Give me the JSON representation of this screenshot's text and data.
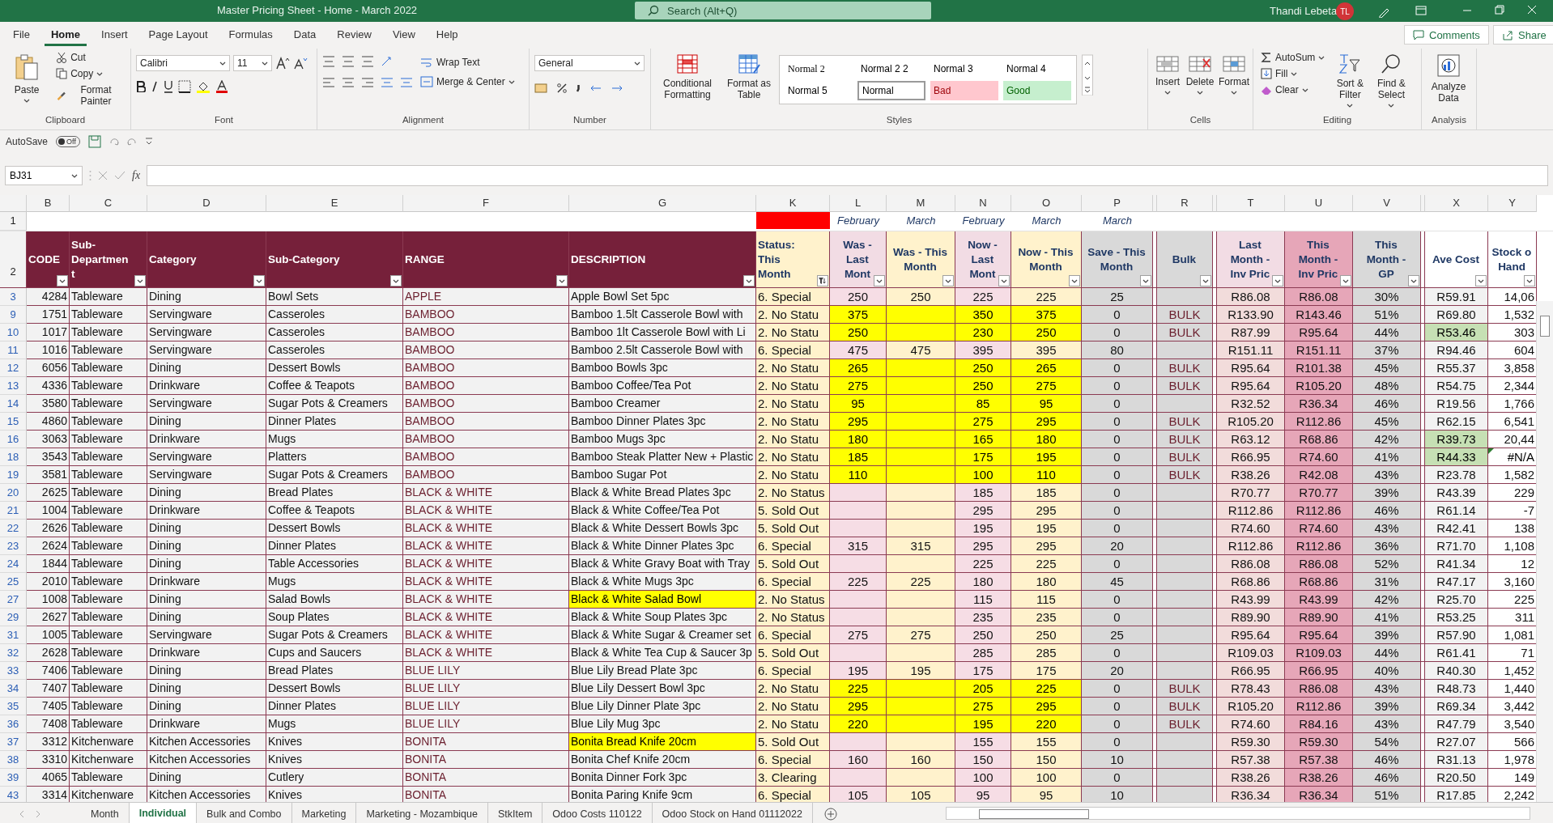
{
  "title_bar": {
    "title": "Master Pricing Sheet - Home - March 2022",
    "search": {
      "placeholder": "Search (Alt+Q)"
    },
    "user": "Thandi Lebeta",
    "avatar": "TL"
  },
  "menu_tabs": [
    {
      "label": "File",
      "selected": false
    },
    {
      "label": "Home",
      "selected": true
    },
    {
      "label": "Insert",
      "selected": false
    },
    {
      "label": "Page Layout",
      "selected": false
    },
    {
      "label": "Formulas",
      "selected": false
    },
    {
      "label": "Data",
      "selected": false
    },
    {
      "label": "Review",
      "selected": false
    },
    {
      "label": "View",
      "selected": false
    },
    {
      "label": "Help",
      "selected": false
    }
  ],
  "header_buttons": {
    "comments": "Comments",
    "share": "Share"
  },
  "ribbon": {
    "clipboard": {
      "paste": "Paste",
      "cut": "Cut",
      "copy": "Copy",
      "format_painter": "Format Painter",
      "label": "Clipboard"
    },
    "font": {
      "family": "Calibri",
      "size": "11",
      "label": "Font"
    },
    "alignment": {
      "wrap": "Wrap Text",
      "merge": "Merge & Center",
      "label": "Alignment"
    },
    "number": {
      "format": "General",
      "label": "Number"
    },
    "styles": {
      "conditional": "Conditional Formatting",
      "format_table": "Format as Table",
      "label": "Styles",
      "gallery": [
        {
          "name": "Normal 2",
          "kind": "serif",
          "selected": false
        },
        {
          "name": "Normal 2 2",
          "kind": "plain",
          "selected": false
        },
        {
          "name": "Normal 3",
          "kind": "plain",
          "selected": false
        },
        {
          "name": "Normal 4",
          "kind": "plain",
          "selected": false
        },
        {
          "name": "Normal 5",
          "kind": "plain",
          "selected": false
        },
        {
          "name": "Normal",
          "kind": "plain",
          "selected": true
        },
        {
          "name": "Bad",
          "kind": "bad",
          "selected": false
        },
        {
          "name": "Good",
          "kind": "good",
          "selected": false
        }
      ]
    },
    "cells": {
      "insert": "Insert",
      "delete": "Delete",
      "format": "Format",
      "label": "Cells"
    },
    "editing": {
      "autosum": "AutoSum",
      "fill": "Fill",
      "clear": "Clear",
      "sort": "Sort & Filter",
      "find": "Find & Select",
      "label": "Editing"
    },
    "analysis": {
      "analyze": "Analyze Data",
      "label": "Analysis"
    }
  },
  "quick_access": {
    "autosave": "AutoSave",
    "autosave_on": false,
    "toggle_label": "Off"
  },
  "formula_bar": {
    "name_box": "BJ31",
    "function_symbol": "fx"
  },
  "sheet": {
    "header_row": "2",
    "period_row": "1",
    "columns": [
      {
        "letter": "B",
        "header": [
          "CODE"
        ],
        "filtered": false
      },
      {
        "letter": "C",
        "header": [
          "Sub-",
          "Departmen",
          "t"
        ],
        "filtered": false
      },
      {
        "letter": "D",
        "header": [
          "Category"
        ],
        "filtered": false
      },
      {
        "letter": "E",
        "header": [
          "Sub-Category"
        ],
        "filtered": false
      },
      {
        "letter": "F",
        "header": [
          "RANGE"
        ],
        "filtered": false
      },
      {
        "letter": "G",
        "header": [
          "DESCRIPTION"
        ],
        "filtered": false
      },
      {
        "letter": "K",
        "header": [
          "Status:",
          "This",
          "Month"
        ],
        "filtered": true,
        "marked": true
      },
      {
        "letter": "L",
        "header": [
          "Was -",
          "Last",
          "Mont"
        ],
        "filtered": false,
        "period": "February"
      },
      {
        "letter": "M",
        "header": [
          "Was - This",
          "Month"
        ],
        "filtered": false,
        "period": "March"
      },
      {
        "letter": "N",
        "header": [
          "Now -",
          "Last",
          "Mont"
        ],
        "filtered": false,
        "period": "February"
      },
      {
        "letter": "O",
        "header": [
          "Now - This",
          "Month"
        ],
        "filtered": false,
        "period": "March"
      },
      {
        "letter": "P",
        "header": [
          "Save - This",
          "Month"
        ],
        "filtered": false,
        "period": "March"
      },
      {
        "letter": "R",
        "header": [
          "Bulk"
        ],
        "filtered": false
      },
      {
        "letter": "T",
        "header": [
          "Last",
          "Month -",
          "Inv Pric"
        ],
        "filtered": false
      },
      {
        "letter": "U",
        "header": [
          "This",
          "Month -",
          "Inv Pric"
        ],
        "filtered": false
      },
      {
        "letter": "V",
        "header": [
          "This",
          "Month -",
          "GP"
        ],
        "filtered": false
      },
      {
        "letter": "X",
        "header": [
          "Ave Cost"
        ],
        "filtered": false
      },
      {
        "letter": "Y",
        "header": [
          "Stock o",
          "Hand"
        ],
        "filtered": false
      }
    ],
    "rows": [
      {
        "row": "3",
        "cells": [
          "4284",
          "Tableware",
          "Dining",
          "Bowl Sets",
          "APPLE",
          "Apple Bowl Set 5pc",
          "6. Special",
          "250",
          "250",
          "225",
          "225",
          "25",
          null,
          "R86.08",
          "R86.08",
          "30%",
          "R59.91",
          "14,06"
        ],
        "price_highlight": false,
        "description_highlight": false,
        "cost_highlight": false,
        "stock_warning": false
      },
      {
        "row": "9",
        "cells": [
          "1751",
          "Tableware",
          "Servingware",
          "Casseroles",
          "BAMBOO",
          "Bamboo 1.5lt Casserole Bowl with",
          "2. No Statu",
          "375",
          null,
          "350",
          "375",
          "0",
          "BULK",
          "R133.90",
          "R143.46",
          "51%",
          "R69.80",
          "1,532"
        ],
        "price_highlight": true,
        "description_highlight": false,
        "cost_highlight": false,
        "stock_warning": false
      },
      {
        "row": "10",
        "cells": [
          "1017",
          "Tableware",
          "Servingware",
          "Casseroles",
          "BAMBOO",
          "Bamboo 1lt Casserole Bowl with Li",
          "2. No Statu",
          "250",
          null,
          "230",
          "250",
          "0",
          "BULK",
          "R87.99",
          "R95.64",
          "44%",
          "R53.46",
          "303"
        ],
        "price_highlight": true,
        "description_highlight": false,
        "cost_highlight": true,
        "stock_warning": false
      },
      {
        "row": "11",
        "cells": [
          "1016",
          "Tableware",
          "Servingware",
          "Casseroles",
          "BAMBOO",
          "Bamboo 2.5lt Casserole Bowl with",
          "6. Special",
          "475",
          "475",
          "395",
          "395",
          "80",
          null,
          "R151.11",
          "R151.11",
          "37%",
          "R94.46",
          "604"
        ],
        "price_highlight": false,
        "description_highlight": false,
        "cost_highlight": false,
        "stock_warning": false
      },
      {
        "row": "12",
        "cells": [
          "6056",
          "Tableware",
          "Dining",
          "Dessert Bowls",
          "BAMBOO",
          "Bamboo Bowls 3pc",
          "2. No Statu",
          "265",
          null,
          "250",
          "265",
          "0",
          "BULK",
          "R95.64",
          "R101.38",
          "45%",
          "R55.37",
          "3,858"
        ],
        "price_highlight": true,
        "description_highlight": false,
        "cost_highlight": false,
        "stock_warning": false
      },
      {
        "row": "13",
        "cells": [
          "4336",
          "Tableware",
          "Drinkware",
          "Coffee & Teapots",
          "BAMBOO",
          "Bamboo Coffee/Tea Pot",
          "2. No Statu",
          "275",
          null,
          "250",
          "275",
          "0",
          "BULK",
          "R95.64",
          "R105.20",
          "48%",
          "R54.75",
          "2,344"
        ],
        "price_highlight": true,
        "description_highlight": false,
        "cost_highlight": false,
        "stock_warning": false
      },
      {
        "row": "14",
        "cells": [
          "3580",
          "Tableware",
          "Servingware",
          "Sugar Pots & Creamers",
          "BAMBOO",
          "Bamboo Creamer",
          "2. No Statu",
          "95",
          null,
          "85",
          "95",
          "0",
          null,
          "R32.52",
          "R36.34",
          "46%",
          "R19.56",
          "1,766"
        ],
        "price_highlight": true,
        "description_highlight": false,
        "cost_highlight": false,
        "stock_warning": false
      },
      {
        "row": "15",
        "cells": [
          "4860",
          "Tableware",
          "Dining",
          "Dinner Plates",
          "BAMBOO",
          "Bamboo Dinner Plates 3pc",
          "2. No Statu",
          "295",
          null,
          "275",
          "295",
          "0",
          "BULK",
          "R105.20",
          "R112.86",
          "45%",
          "R62.15",
          "6,541"
        ],
        "price_highlight": true,
        "description_highlight": false,
        "cost_highlight": false,
        "stock_warning": false
      },
      {
        "row": "16",
        "cells": [
          "3063",
          "Tableware",
          "Drinkware",
          "Mugs",
          "BAMBOO",
          "Bamboo Mugs 3pc",
          "2. No Statu",
          "180",
          null,
          "165",
          "180",
          "0",
          "BULK",
          "R63.12",
          "R68.86",
          "42%",
          "R39.73",
          "20,44"
        ],
        "price_highlight": true,
        "description_highlight": false,
        "cost_highlight": true,
        "stock_warning": false
      },
      {
        "row": "18",
        "cells": [
          "3543",
          "Tableware",
          "Servingware",
          "Platters",
          "BAMBOO",
          "Bamboo Steak Platter New + Plastic",
          "2. No Statu",
          "185",
          null,
          "175",
          "195",
          "0",
          "BULK",
          "R66.95",
          "R74.60",
          "41%",
          "R44.33",
          "#N/A"
        ],
        "price_highlight": true,
        "description_highlight": false,
        "cost_highlight": true,
        "stock_warning": true
      },
      {
        "row": "19",
        "cells": [
          "3581",
          "Tableware",
          "Servingware",
          "Sugar Pots & Creamers",
          "BAMBOO",
          "Bamboo Sugar Pot",
          "2. No Statu",
          "110",
          null,
          "100",
          "110",
          "0",
          "BULK",
          "R38.26",
          "R42.08",
          "43%",
          "R23.78",
          "1,582"
        ],
        "price_highlight": true,
        "description_highlight": false,
        "cost_highlight": false,
        "stock_warning": false
      },
      {
        "row": "20",
        "cells": [
          "2625",
          "Tableware",
          "Dining",
          "Bread Plates",
          "BLACK & WHITE",
          "Black & White Bread Plates 3pc",
          "2. No Status",
          null,
          null,
          "185",
          "185",
          "0",
          null,
          "R70.77",
          "R70.77",
          "39%",
          "R43.39",
          "229"
        ],
        "price_highlight": false,
        "description_highlight": false,
        "cost_highlight": false,
        "stock_warning": false
      },
      {
        "row": "21",
        "cells": [
          "1004",
          "Tableware",
          "Drinkware",
          "Coffee & Teapots",
          "BLACK & WHITE",
          "Black & White Coffee/Tea Pot",
          "5. Sold Out",
          null,
          null,
          "295",
          "295",
          "0",
          null,
          "R112.86",
          "R112.86",
          "46%",
          "R61.14",
          "-7"
        ],
        "price_highlight": false,
        "description_highlight": false,
        "cost_highlight": false,
        "stock_warning": false
      },
      {
        "row": "22",
        "cells": [
          "2626",
          "Tableware",
          "Dining",
          "Dessert Bowls",
          "BLACK & WHITE",
          "Black & White Dessert Bowls 3pc",
          "5. Sold Out",
          null,
          null,
          "195",
          "195",
          "0",
          null,
          "R74.60",
          "R74.60",
          "43%",
          "R42.41",
          "138"
        ],
        "price_highlight": false,
        "description_highlight": false,
        "cost_highlight": false,
        "stock_warning": false
      },
      {
        "row": "23",
        "cells": [
          "2624",
          "Tableware",
          "Dining",
          "Dinner Plates",
          "BLACK & WHITE",
          "Black & White Dinner Plates 3pc",
          "6. Special",
          "315",
          "315",
          "295",
          "295",
          "20",
          null,
          "R112.86",
          "R112.86",
          "36%",
          "R71.70",
          "1,108"
        ],
        "price_highlight": false,
        "description_highlight": false,
        "cost_highlight": false,
        "stock_warning": false
      },
      {
        "row": "24",
        "cells": [
          "1844",
          "Tableware",
          "Dining",
          "Table Accessories",
          "BLACK & WHITE",
          "Black & White Gravy Boat with Tray",
          "5. Sold Out",
          null,
          null,
          "225",
          "225",
          "0",
          null,
          "R86.08",
          "R86.08",
          "52%",
          "R41.34",
          "12"
        ],
        "price_highlight": false,
        "description_highlight": false,
        "cost_highlight": false,
        "stock_warning": false
      },
      {
        "row": "25",
        "cells": [
          "2010",
          "Tableware",
          "Drinkware",
          "Mugs",
          "BLACK & WHITE",
          "Black & White Mugs 3pc",
          "6. Special",
          "225",
          "225",
          "180",
          "180",
          "45",
          null,
          "R68.86",
          "R68.86",
          "31%",
          "R47.17",
          "3,160"
        ],
        "price_highlight": false,
        "description_highlight": false,
        "cost_highlight": false,
        "stock_warning": false
      },
      {
        "row": "27",
        "cells": [
          "1008",
          "Tableware",
          "Dining",
          "Salad Bowls",
          "BLACK & WHITE",
          "Black & White Salad Bowl",
          "2. No Status",
          null,
          null,
          "115",
          "115",
          "0",
          null,
          "R43.99",
          "R43.99",
          "42%",
          "R25.70",
          "225"
        ],
        "price_highlight": false,
        "description_highlight": true,
        "cost_highlight": false,
        "stock_warning": false
      },
      {
        "row": "29",
        "cells": [
          "2627",
          "Tableware",
          "Dining",
          "Soup Plates",
          "BLACK & WHITE",
          "Black & White Soup Plates 3pc",
          "2. No Status",
          null,
          null,
          "235",
          "235",
          "0",
          null,
          "R89.90",
          "R89.90",
          "41%",
          "R53.25",
          "311"
        ],
        "price_highlight": false,
        "description_highlight": false,
        "cost_highlight": false,
        "stock_warning": false
      },
      {
        "row": "31",
        "cells": [
          "1005",
          "Tableware",
          "Servingware",
          "Sugar Pots & Creamers",
          "BLACK & WHITE",
          "Black & White Sugar & Creamer set",
          "6. Special",
          "275",
          "275",
          "250",
          "250",
          "25",
          null,
          "R95.64",
          "R95.64",
          "39%",
          "R57.90",
          "1,081"
        ],
        "price_highlight": false,
        "description_highlight": false,
        "cost_highlight": false,
        "stock_warning": false
      },
      {
        "row": "32",
        "cells": [
          "2628",
          "Tableware",
          "Drinkware",
          "Cups and Saucers",
          "BLACK & WHITE",
          "Black & White Tea Cup & Saucer 3p",
          "5. Sold Out",
          null,
          null,
          "285",
          "285",
          "0",
          null,
          "R109.03",
          "R109.03",
          "44%",
          "R61.41",
          "71"
        ],
        "price_highlight": false,
        "description_highlight": false,
        "cost_highlight": false,
        "stock_warning": false
      },
      {
        "row": "33",
        "cells": [
          "7406",
          "Tableware",
          "Dining",
          "Bread Plates",
          "BLUE LILY",
          "Blue Lily Bread Plate 3pc",
          "6. Special",
          "195",
          "195",
          "175",
          "175",
          "20",
          null,
          "R66.95",
          "R66.95",
          "40%",
          "R40.30",
          "1,452"
        ],
        "price_highlight": false,
        "description_highlight": false,
        "cost_highlight": false,
        "stock_warning": false
      },
      {
        "row": "34",
        "cells": [
          "7407",
          "Tableware",
          "Dining",
          "Dessert Bowls",
          "BLUE LILY",
          "Blue Lily Dessert Bowl 3pc",
          "2. No Statu",
          "225",
          null,
          "205",
          "225",
          "0",
          "BULK",
          "R78.43",
          "R86.08",
          "43%",
          "R48.73",
          "1,440"
        ],
        "price_highlight": true,
        "description_highlight": false,
        "cost_highlight": false,
        "stock_warning": false
      },
      {
        "row": "35",
        "cells": [
          "7405",
          "Tableware",
          "Dining",
          "Dinner Plates",
          "BLUE LILY",
          "Blue Lily Dinner Plate 3pc",
          "2. No Statu",
          "295",
          null,
          "275",
          "295",
          "0",
          "BULK",
          "R105.20",
          "R112.86",
          "39%",
          "R69.34",
          "3,442"
        ],
        "price_highlight": true,
        "description_highlight": false,
        "cost_highlight": false,
        "stock_warning": false
      },
      {
        "row": "36",
        "cells": [
          "7408",
          "Tableware",
          "Drinkware",
          "Mugs",
          "BLUE LILY",
          "Blue Lily Mug 3pc",
          "2. No Statu",
          "220",
          null,
          "195",
          "220",
          "0",
          "BULK",
          "R74.60",
          "R84.16",
          "43%",
          "R47.79",
          "3,540"
        ],
        "price_highlight": true,
        "description_highlight": false,
        "cost_highlight": false,
        "stock_warning": false
      },
      {
        "row": "37",
        "cells": [
          "3312",
          "Kitchenware",
          "Kitchen Accessories",
          "Knives",
          "BONITA",
          "Bonita Bread Knife 20cm",
          "5. Sold Out",
          null,
          null,
          "155",
          "155",
          "0",
          null,
          "R59.30",
          "R59.30",
          "54%",
          "R27.07",
          "566"
        ],
        "price_highlight": false,
        "description_highlight": true,
        "cost_highlight": false,
        "stock_warning": false
      },
      {
        "row": "38",
        "cells": [
          "3310",
          "Kitchenware",
          "Kitchen Accessories",
          "Knives",
          "BONITA",
          "Bonita Chef Knife 20cm",
          "6. Special",
          "160",
          "160",
          "150",
          "150",
          "10",
          null,
          "R57.38",
          "R57.38",
          "46%",
          "R31.13",
          "1,978"
        ],
        "price_highlight": false,
        "description_highlight": false,
        "cost_highlight": false,
        "stock_warning": false
      },
      {
        "row": "39",
        "cells": [
          "4065",
          "Tableware",
          "Dining",
          "Cutlery",
          "BONITA",
          "Bonita Dinner Fork 3pc",
          "3. Clearing",
          null,
          null,
          "100",
          "100",
          "0",
          null,
          "R38.26",
          "R38.26",
          "46%",
          "R20.50",
          "149"
        ],
        "price_highlight": false,
        "description_highlight": false,
        "cost_highlight": false,
        "stock_warning": false
      },
      {
        "row": "43",
        "cells": [
          "3314",
          "Kitchenware",
          "Kitchen Accessories",
          "Knives",
          "BONITA",
          "Bonita Paring Knife 9cm",
          "6. Special",
          "105",
          "105",
          "95",
          "95",
          "10",
          null,
          "R36.34",
          "R36.34",
          "51%",
          "R17.85",
          "2,242"
        ],
        "price_highlight": false,
        "description_highlight": false,
        "cost_highlight": false,
        "stock_warning": false
      }
    ]
  },
  "sheet_tabs": [
    {
      "label": "Month",
      "selected": false
    },
    {
      "label": "Individual",
      "selected": true
    },
    {
      "label": "Bulk and Combo",
      "selected": false
    },
    {
      "label": "Marketing",
      "selected": false
    },
    {
      "label": "Marketing - Mozambique",
      "selected": false
    },
    {
      "label": "StkItem",
      "selected": false
    },
    {
      "label": "Odoo Costs 110122",
      "selected": false
    },
    {
      "label": "Odoo Stock on Hand 01112022",
      "selected": false
    }
  ]
}
